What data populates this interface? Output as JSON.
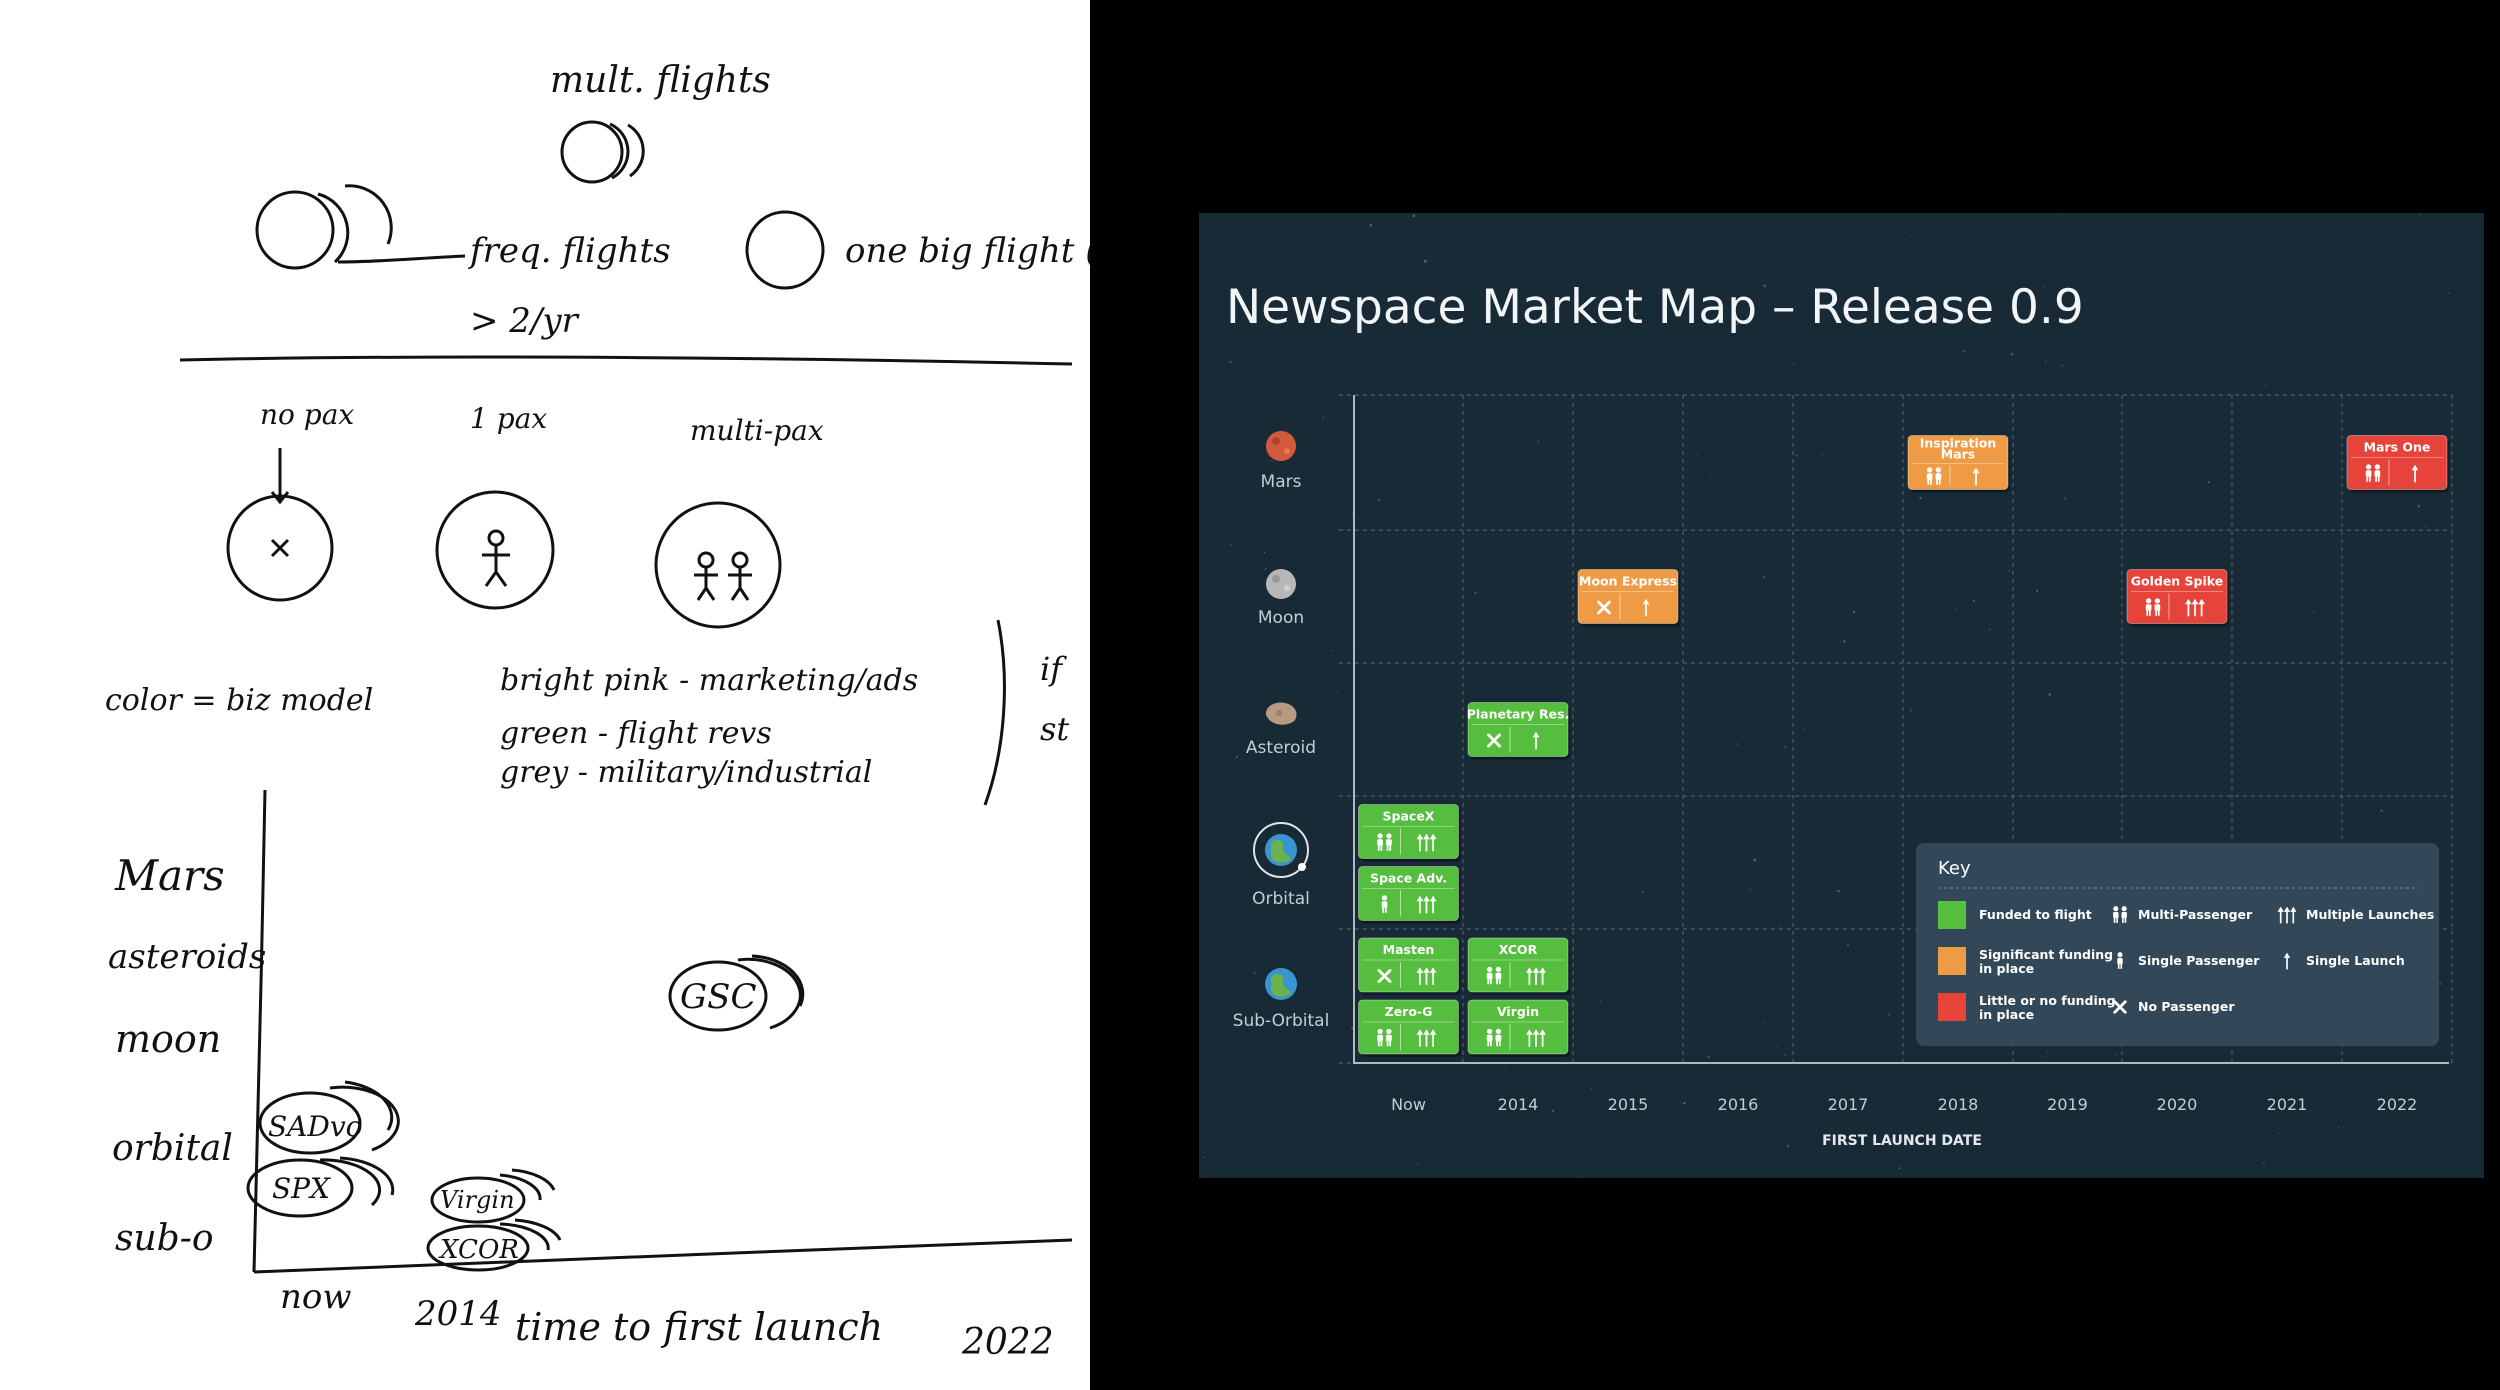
{
  "sketch": {
    "freq_labels": [
      "mult. flights",
      "freq. flights",
      "> 2/yr",
      "one big flight ("
    ],
    "pax_labels": [
      "no pax",
      "1 pax",
      "multi-pax"
    ],
    "color_label": "color = biz model",
    "color_items": [
      "bright pink - marketing/ads",
      "green - flight revs",
      "grey - military/industrial"
    ],
    "margin_marks": [
      "if",
      "st"
    ],
    "y_labels": [
      "Mars",
      "asteroids",
      "moon",
      "orbital",
      "sub-o"
    ],
    "x_labels": [
      "now",
      "2014",
      "time to first launch",
      "2022"
    ],
    "bubbles": [
      "GSC",
      "SADvo",
      "SPX",
      "Virgin",
      "XCOR"
    ]
  },
  "map": {
    "title": "Newspace Market Map – Release 0.9",
    "rows": [
      "Mars",
      "Moon",
      "Asteroid",
      "Orbital",
      "Sub-Orbital"
    ],
    "years": [
      "Now",
      "2014",
      "2015",
      "2016",
      "2017",
      "2018",
      "2019",
      "2020",
      "2021",
      "2022"
    ],
    "x_axis_title": "FIRST LAUNCH DATE",
    "colors": {
      "green": "#56be3e",
      "orange": "#ef9a44",
      "red": "#e6443a"
    },
    "companies": [
      {
        "name": "Inspiration Mars",
        "lines": [
          "Inspiration",
          "Mars"
        ],
        "row": "Mars",
        "year": "2018",
        "status": "orange",
        "passenger": "multi",
        "launch": "single"
      },
      {
        "name": "Mars One",
        "lines": [
          "Mars One"
        ],
        "row": "Mars",
        "year": "2022",
        "status": "red",
        "passenger": "multi",
        "launch": "single"
      },
      {
        "name": "Moon Express",
        "lines": [
          "Moon Express"
        ],
        "row": "Moon",
        "year": "2015",
        "status": "orange",
        "passenger": "none",
        "launch": "single"
      },
      {
        "name": "Golden Spike",
        "lines": [
          "Golden Spike"
        ],
        "row": "Moon",
        "year": "2020",
        "status": "red",
        "passenger": "multi",
        "launch": "multiple"
      },
      {
        "name": "Planetary Res.",
        "lines": [
          "Planetary Res."
        ],
        "row": "Asteroid",
        "year": "2014",
        "status": "green",
        "passenger": "none",
        "launch": "single"
      },
      {
        "name": "SpaceX",
        "lines": [
          "SpaceX"
        ],
        "row": "Orbital",
        "year": "Now",
        "status": "green",
        "passenger": "multi",
        "launch": "multiple"
      },
      {
        "name": "Space Adv.",
        "lines": [
          "Space Adv."
        ],
        "row": "Orbital",
        "year": "Now",
        "status": "green",
        "passenger": "single",
        "launch": "multiple"
      },
      {
        "name": "Masten",
        "lines": [
          "Masten"
        ],
        "row": "Sub-Orbital",
        "year": "Now",
        "status": "green",
        "passenger": "none",
        "launch": "multiple"
      },
      {
        "name": "Zero-G",
        "lines": [
          "Zero-G"
        ],
        "row": "Sub-Orbital",
        "year": "Now",
        "status": "green",
        "passenger": "multi",
        "launch": "multiple"
      },
      {
        "name": "XCOR",
        "lines": [
          "XCOR"
        ],
        "row": "Sub-Orbital",
        "year": "2014",
        "status": "green",
        "passenger": "multi",
        "launch": "multiple"
      },
      {
        "name": "Virgin",
        "lines": [
          "Virgin"
        ],
        "row": "Sub-Orbital",
        "year": "2014",
        "status": "green",
        "passenger": "multi",
        "launch": "multiple"
      }
    ],
    "key": {
      "title": "Key",
      "funding": [
        {
          "color": "green",
          "lines": [
            "Funded to flight"
          ]
        },
        {
          "color": "orange",
          "lines": [
            "Significant funding",
            "in place"
          ]
        },
        {
          "color": "red",
          "lines": [
            "Little or no funding",
            "in place"
          ]
        }
      ],
      "passengers": [
        {
          "icon": "multi",
          "label": "Multi-Passenger"
        },
        {
          "icon": "single",
          "label": "Single Passenger"
        },
        {
          "icon": "none",
          "label": "No Passenger"
        }
      ],
      "launches": [
        {
          "icon": "multiple",
          "label": "Multiple Launches"
        },
        {
          "icon": "single",
          "label": "Single Launch"
        }
      ]
    }
  }
}
